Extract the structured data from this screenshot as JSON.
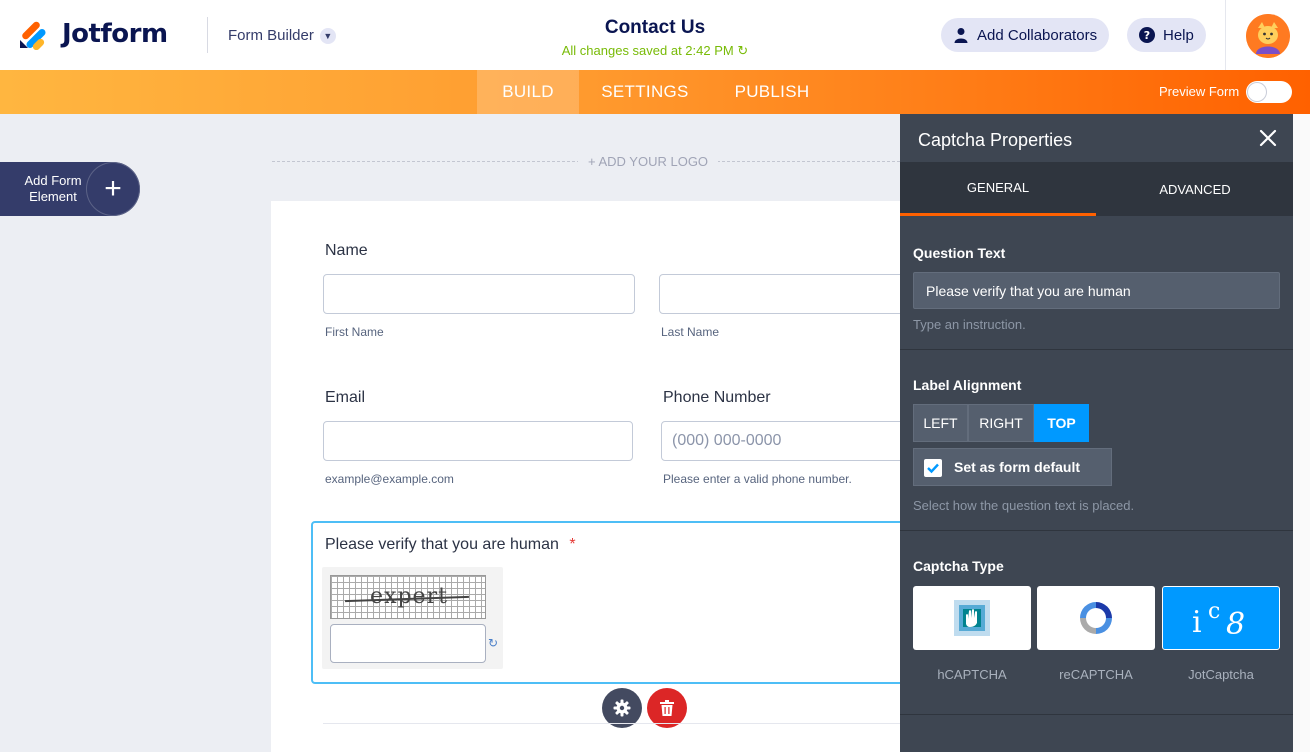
{
  "header": {
    "brand": "Jotform",
    "builder_label": "Form Builder",
    "form_title": "Contact Us",
    "saved_status": "All changes saved at 2:42 PM",
    "add_collaborators": "Add Collaborators",
    "help": "Help"
  },
  "nav": {
    "tabs": [
      "BUILD",
      "SETTINGS",
      "PUBLISH"
    ],
    "active_tab": "BUILD",
    "preview_label": "Preview Form",
    "preview_on": false
  },
  "canvas": {
    "add_element_label": "Add Form Element",
    "add_logo": "+ ADD YOUR LOGO"
  },
  "form": {
    "name": {
      "label": "Name",
      "first_sub": "First Name",
      "last_sub": "Last Name"
    },
    "email": {
      "label": "Email",
      "sub": "example@example.com"
    },
    "phone": {
      "label": "Phone Number",
      "placeholder": "(000) 000-0000",
      "sub": "Please enter a valid phone number."
    },
    "captcha": {
      "label": "Please verify that you are human",
      "required_mark": "*",
      "image_word": "expert"
    }
  },
  "panel": {
    "title": "Captcha Properties",
    "tabs": [
      "GENERAL",
      "ADVANCED"
    ],
    "active_tab": "GENERAL",
    "question_text": {
      "label": "Question Text",
      "value": "Please verify that you are human",
      "help": "Type an instruction."
    },
    "label_alignment": {
      "label": "Label Alignment",
      "options": [
        "LEFT",
        "RIGHT",
        "TOP"
      ],
      "selected": "TOP",
      "default_label": "Set as form default",
      "default_checked": true,
      "help": "Select how the question text is placed."
    },
    "captcha_type": {
      "label": "Captcha Type",
      "options": [
        "hCAPTCHA",
        "reCAPTCHA",
        "JotCaptcha"
      ],
      "selected": "JotCaptcha"
    }
  },
  "colors": {
    "brand_orange": "#ff6100",
    "accent_blue": "#0099ff",
    "navy": "#0a1551",
    "saved_green": "#78bb07",
    "panel_bg": "#3e4652"
  }
}
